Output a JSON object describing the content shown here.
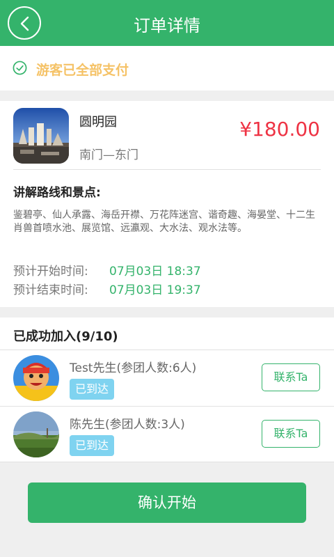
{
  "header": {
    "title": "订单详情"
  },
  "payment": {
    "status_text": "游客已全部支付"
  },
  "order": {
    "spot_name": "圆明园",
    "route": "南门—东门",
    "price": "¥180.00",
    "guide_title": "讲解路线和景点:",
    "guide_spots": "鉴碧亭、仙人承露、海岳开襟、万花阵迷宫、谐奇趣、海晏堂、十二生肖兽首喷水池、展览馆、远瀛观、大水法、观水法等。",
    "start_label": "预计开始时间:",
    "start_value": "07月03日 18:37",
    "end_label": "预计结束时间:",
    "end_value": "07月03日 19:37"
  },
  "members": {
    "title": "已成功加入(9/10)",
    "list": [
      {
        "name": "Test先生(参团人数:6人)",
        "status": "已到达",
        "contact_label": "联系Ta"
      },
      {
        "name": "陈先生(参团人数:3人)",
        "status": "已到达",
        "contact_label": "联系Ta"
      }
    ]
  },
  "confirm_label": "确认开始",
  "colors": {
    "primary": "#34b36b",
    "price": "#ee3344",
    "pay_status": "#f5c266",
    "badge": "#7fd3f0"
  },
  "icons": [
    "back-arrow-icon",
    "check-circle-icon"
  ]
}
